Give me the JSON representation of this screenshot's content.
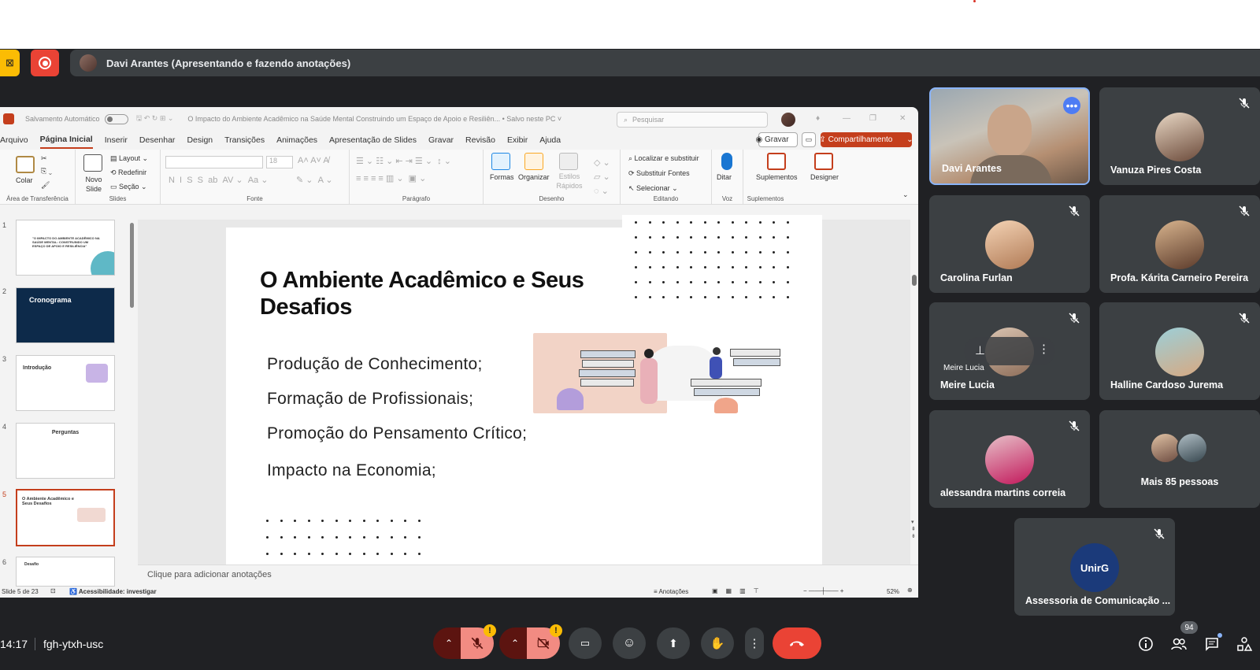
{
  "presenter_bar": {
    "text": "Davi Arantes (Apresentando e fazendo anotações)"
  },
  "ppt": {
    "autosave_label": "Salvamento Automático",
    "doc_title": "O Impacto do Ambiente Acadêmico na Saúde Mental Construindo um Espaço de Apoio e Resiliên... • Salvo neste PC ˅",
    "search_placeholder": "Pesquisar",
    "menu": [
      "Arquivo",
      "Página Inicial",
      "Inserir",
      "Desenhar",
      "Design",
      "Transições",
      "Animações",
      "Apresentação de Slides",
      "Gravar",
      "Revisão",
      "Exibir",
      "Ajuda"
    ],
    "record_label": "Gravar",
    "share_label": "Compartilhamento",
    "ribbon": {
      "paste": "Colar",
      "new_slide": "Novo Slide",
      "layout": "Layout",
      "reset": "Redefinir",
      "section": "Seção",
      "font_size": "18",
      "shapes": "Formas",
      "arrange": "Organizar",
      "quick_styles": "Estilos Rápidos",
      "find_replace": "Localizar e substituir",
      "replace_fonts": "Substituir Fontes",
      "select": "Selecionar",
      "dictate": "Ditar",
      "addins": "Suplementos",
      "designer": "Designer",
      "groups": [
        "Área de Transferência",
        "Slides",
        "Fonte",
        "Parágrafo",
        "Desenho",
        "Editando",
        "Voz",
        "Suplementos"
      ]
    },
    "slide": {
      "title": "O Ambiente Acadêmico e Seus Desafios",
      "bullets": [
        "Produção de Conhecimento;",
        "Formação de Profissionais;",
        "Promoção do Pensamento Crítico;",
        "Impacto na Economia;"
      ]
    },
    "thumbnails": [
      {
        "num": "1",
        "text": "\"O IMPACTO DO AMBIENTE ACADÊMICO NA SAÚDE MENTAL: CONSTRUINDO UM ESPAÇO DE APOIO E RESILIÊNCIA\""
      },
      {
        "num": "2",
        "text": "Cronograma"
      },
      {
        "num": "3",
        "text": "Introdução"
      },
      {
        "num": "4",
        "text": "Perguntas"
      },
      {
        "num": "5",
        "text": "O Ambiente Acadêmico e Seus Desafios"
      },
      {
        "num": "6",
        "text": "Desafio"
      }
    ],
    "notes_placeholder": "Clique para adicionar anotações",
    "status": {
      "slide_count": "Slide 5 de 23",
      "accessibility": "Acessibilidade: investigar",
      "notes": "Anotações",
      "zoom": "52%"
    }
  },
  "participants": [
    {
      "name": "Davi Arantes"
    },
    {
      "name": "Vanuza Pires Costa"
    },
    {
      "name": "Carolina Furlan"
    },
    {
      "name": "Profa. Kárita Carneiro Pereira"
    },
    {
      "name": "Meire Lucia",
      "hover_label": "Meire Lucia"
    },
    {
      "name": "Halline Cardoso Jurema"
    },
    {
      "name": "alessandra martins correia"
    },
    {
      "name": "Mais 85 pessoas"
    },
    {
      "name": "Assessoria de Comunicação ...",
      "logo_text": "UnirG"
    }
  ],
  "meeting": {
    "time": "14:17",
    "code": "fgh-ytxh-usc",
    "people_count": "94",
    "warning_mark": "!"
  },
  "colors": {
    "meet_bg": "#202124",
    "tile_bg": "#3c4043",
    "end_call": "#ea4335",
    "ppt_accent": "#c43e1c",
    "active_speaker_border": "#8ab4f8"
  }
}
